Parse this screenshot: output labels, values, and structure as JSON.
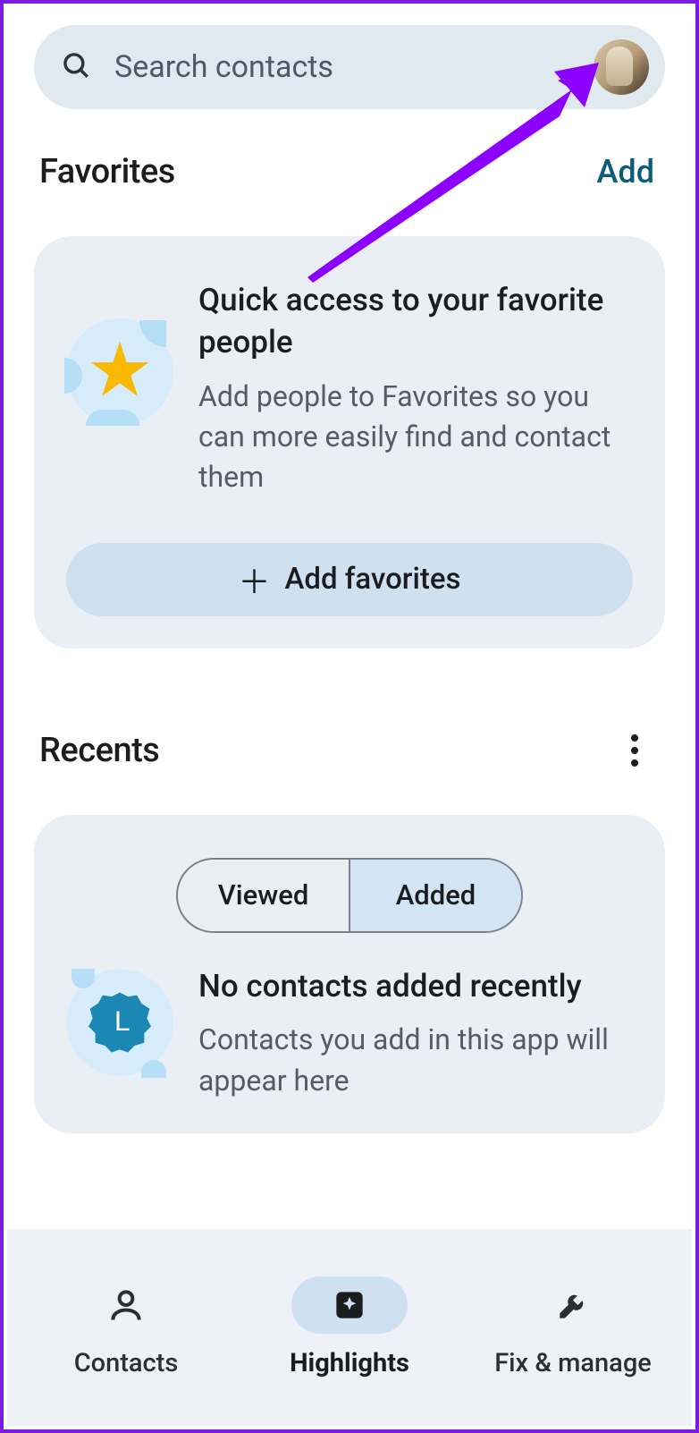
{
  "search": {
    "placeholder": "Search contacts"
  },
  "favorites": {
    "heading": "Favorites",
    "add_link": "Add",
    "card_title": "Quick access to your favorite people",
    "card_subtitle": "Add people to Favorites so you can more easily find and contact them",
    "add_button": "Add favorites"
  },
  "recents": {
    "heading": "Recents",
    "tabs": {
      "viewed": "Viewed",
      "added": "Added",
      "selected": "added"
    },
    "card_title": "No contacts added recently",
    "card_subtitle": "Contacts you add in this app will appear here"
  },
  "nav": {
    "contacts": "Contacts",
    "highlights": "Highlights",
    "fix_manage": "Fix & manage",
    "active": "highlights"
  },
  "colors": {
    "accent": "#cfe1f1",
    "surface": "#eaeff5",
    "search_bg": "#e0e9f0",
    "link": "#0a5c78",
    "annotation": "#8b00ff"
  }
}
